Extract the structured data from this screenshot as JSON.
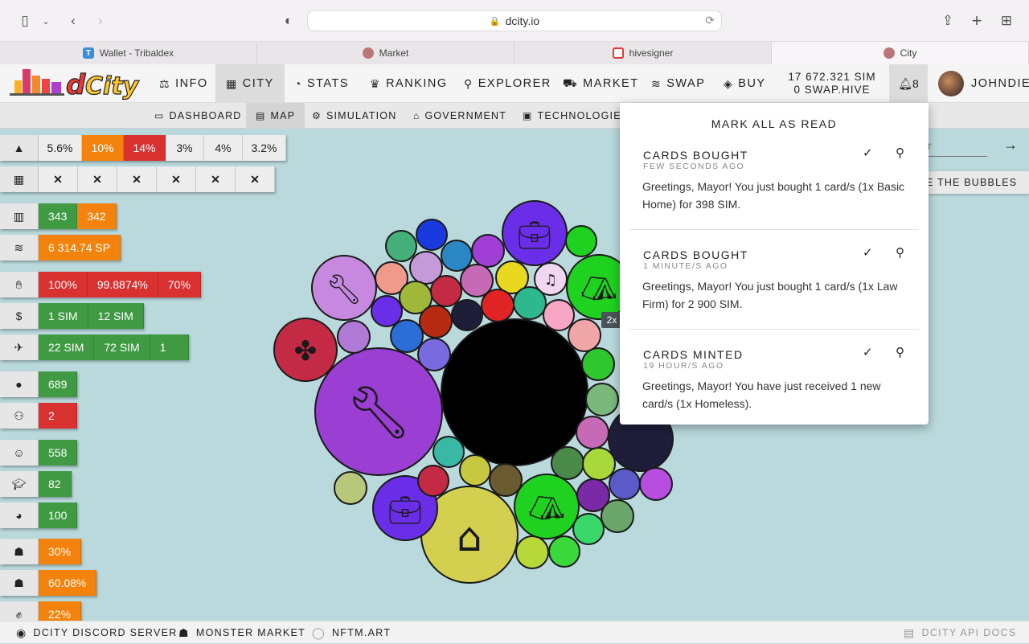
{
  "browser": {
    "url": "dcity.io",
    "tabs": [
      {
        "label": "Wallet - Tribaldex",
        "icon": "tribaldex-icon"
      },
      {
        "label": "Market",
        "icon": "market-icon"
      },
      {
        "label": "hivesigner",
        "icon": "hivesigner-icon"
      },
      {
        "label": "City",
        "icon": "city-icon"
      }
    ]
  },
  "nav": {
    "items": [
      {
        "label": "INFO",
        "icon": "scale-icon"
      },
      {
        "label": "CITY",
        "icon": "city-icon"
      },
      {
        "label": "STATS",
        "icon": "pie-icon"
      },
      {
        "label": "RANKING",
        "icon": "trophy-icon"
      },
      {
        "label": "EXPLORER",
        "icon": "search-icon"
      },
      {
        "label": "MARKET",
        "icon": "cart-icon"
      },
      {
        "label": "SWAP",
        "icon": "coins-icon"
      },
      {
        "label": "BUY",
        "icon": "layers-icon"
      }
    ],
    "balance_sim": "17 672.321 SIM",
    "balance_hive": "0 SWAP.HIVE",
    "notif_count": "8",
    "username": "JOHNDIEG"
  },
  "subnav": {
    "items": [
      {
        "label": "DASHBOARD",
        "icon": "monitor-icon"
      },
      {
        "label": "MAP",
        "icon": "map-icon"
      },
      {
        "label": "SIMULATION",
        "icon": "simulation-icon"
      },
      {
        "label": "GOVERNMENT",
        "icon": "government-icon"
      },
      {
        "label": "TECHNOLOGIES",
        "icon": "chip-icon"
      }
    ]
  },
  "stats": {
    "risk": [
      "5.6%",
      "10%",
      "14%",
      "3%",
      "4%",
      "3.2%"
    ],
    "calendar": [
      "✕",
      "✕",
      "✕",
      "✕",
      "✕",
      "✕"
    ],
    "buildings": [
      "343",
      "342"
    ],
    "sp": "6 314.74 SP",
    "income": [
      "100%",
      "99.8874%",
      "70%"
    ],
    "sim": [
      "1 SIM",
      "12 SIM"
    ],
    "flights": [
      "22 SIM",
      "72 SIM",
      "1"
    ],
    "population": "689",
    "workers": "2",
    "happiness": "558",
    "education": "82",
    "culture": "100",
    "crime": "30%",
    "police": "60.08%",
    "protest": "22%"
  },
  "map": {
    "search_placeholder": "r",
    "bubbles_label": "E THE BUBBLES",
    "speed_badge": "2x"
  },
  "notifications": {
    "mark_all": "MARK ALL AS READ",
    "items": [
      {
        "title": "CARDS BOUGHT",
        "ago": "FEW SECONDS AGO",
        "message": "Greetings, Mayor! You just bought 1 card/s (1x Basic Home) for 398 SIM."
      },
      {
        "title": "CARDS BOUGHT",
        "ago": "1 MINUTE/S AGO",
        "message": "Greetings, Mayor! You just bought 1 card/s (1x Law Firm) for 2 900 SIM."
      },
      {
        "title": "CARDS MINTED",
        "ago": "19 HOUR/S AGO",
        "message": "Greetings, Mayor! You have just received 1 new card/s (1x Homeless)."
      }
    ]
  },
  "footer": {
    "discord": "DCITY DISCORD SERVER",
    "monster": "MONSTER MARKET",
    "nftm": "NFTM.ART",
    "api": "DCITY API DOCS"
  },
  "colors": {
    "green": "#3f9a43",
    "orange": "#f4830d",
    "red": "#d93030",
    "map_bg": "#b9d9dc"
  }
}
